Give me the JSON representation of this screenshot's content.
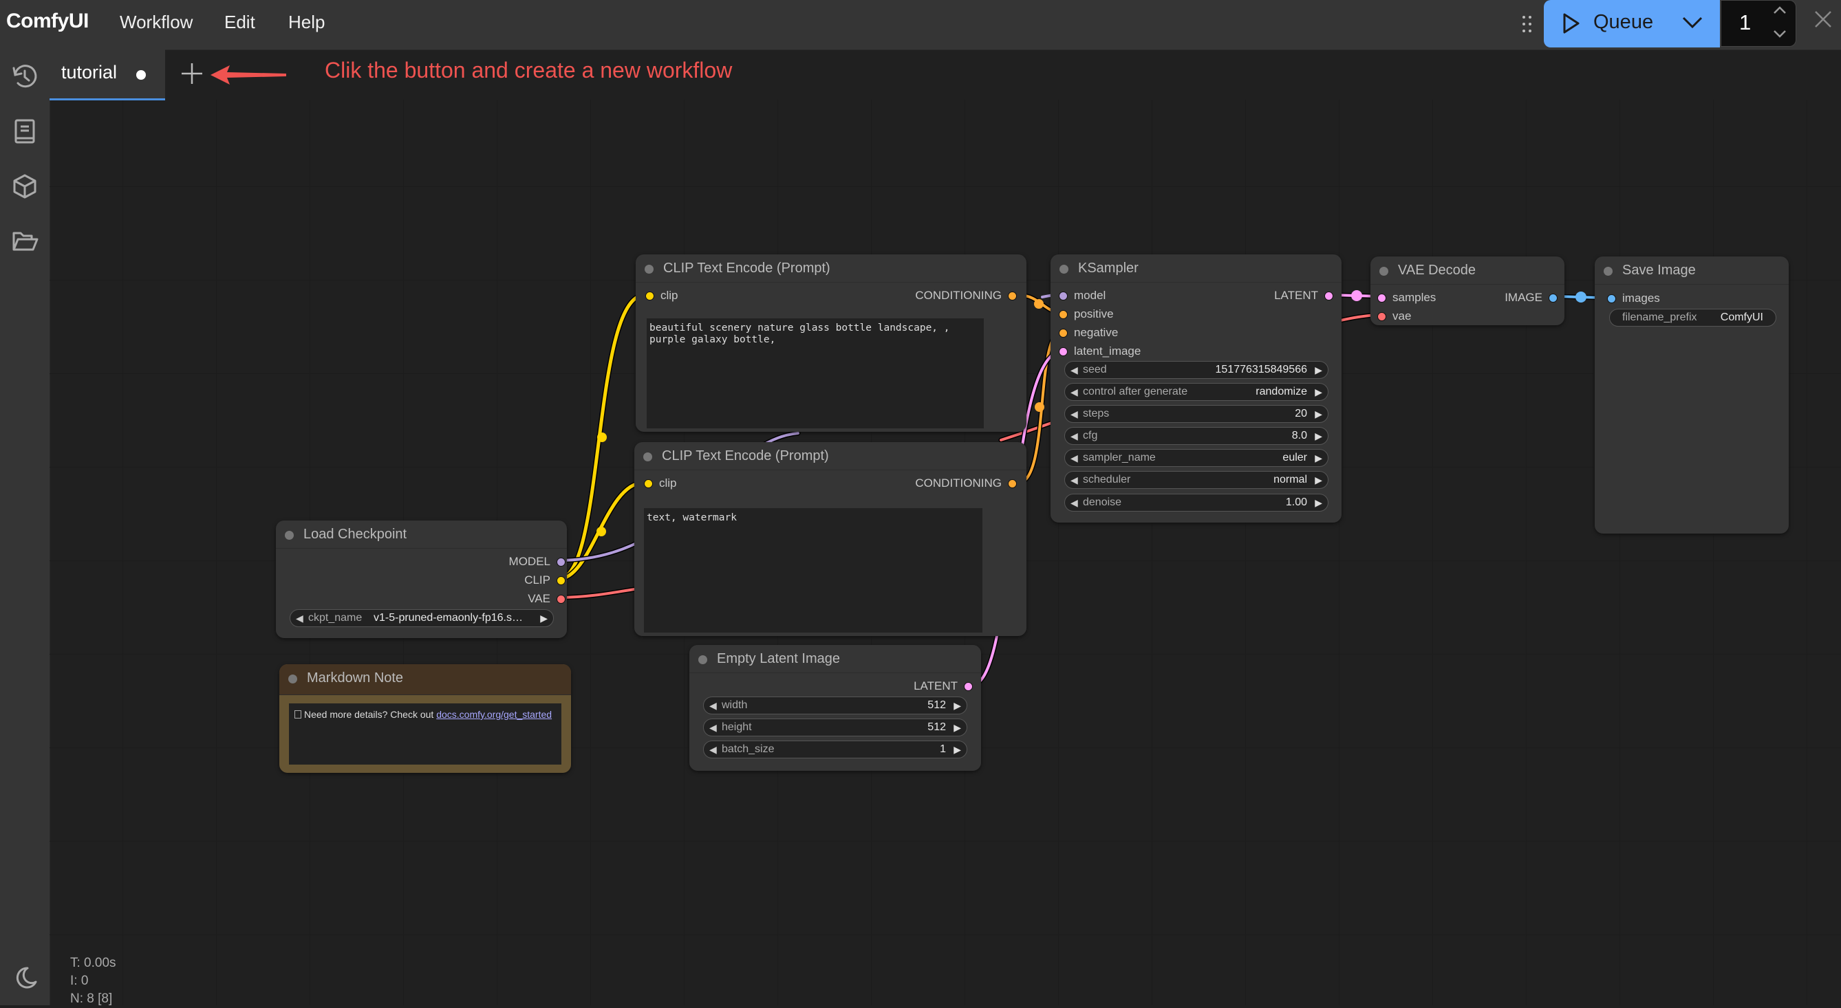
{
  "app": {
    "logo": "ComfyUI"
  },
  "menu": {
    "items": [
      "Workflow",
      "Edit",
      "Help"
    ]
  },
  "queue": {
    "label": "Queue",
    "count": "1"
  },
  "sidebar": {
    "icons": [
      "history-icon",
      "book-icon",
      "cube-icon",
      "folder-open-icon"
    ],
    "bottom_icon": "moon-icon"
  },
  "tabs": [
    {
      "label": "tutorial",
      "unsaved": true
    }
  ],
  "annotation": {
    "text": "Clik the button and create a new workflow",
    "color": "#ef5350"
  },
  "colors": {
    "accent": "#60a5fa",
    "clip": "#ffd500",
    "model": "#b39ddb",
    "vae": "#ff6e6e",
    "conditioning": "#ffa931",
    "latent": "#ff9cf9",
    "image": "#64b5f6"
  },
  "nodes": {
    "clip_pos": {
      "title": "CLIP Text Encode (Prompt)",
      "input": "clip",
      "output": "CONDITIONING",
      "text": "beautiful scenery nature glass bottle landscape, , purple galaxy bottle,"
    },
    "clip_neg": {
      "title": "CLIP Text Encode (Prompt)",
      "input": "clip",
      "output": "CONDITIONING",
      "text": "text, watermark"
    },
    "ksampler": {
      "title": "KSampler",
      "inputs": [
        "model",
        "positive",
        "negative",
        "latent_image"
      ],
      "output": "LATENT",
      "widgets": [
        {
          "name": "seed",
          "value": "151776315849566"
        },
        {
          "name": "control after generate",
          "value": "randomize"
        },
        {
          "name": "steps",
          "value": "20"
        },
        {
          "name": "cfg",
          "value": "8.0"
        },
        {
          "name": "sampler_name",
          "value": "euler"
        },
        {
          "name": "scheduler",
          "value": "normal"
        },
        {
          "name": "denoise",
          "value": "1.00"
        }
      ]
    },
    "vae_decode": {
      "title": "VAE Decode",
      "inputs": [
        "samples",
        "vae"
      ],
      "output": "IMAGE"
    },
    "save_image": {
      "title": "Save Image",
      "input": "images",
      "widget": {
        "name": "filename_prefix",
        "value": "ComfyUI"
      }
    },
    "load_checkpoint": {
      "title": "Load Checkpoint",
      "outputs": [
        "MODEL",
        "CLIP",
        "VAE"
      ],
      "widget": {
        "name": "ckpt_name",
        "value": "v1-5-pruned-emaonly-fp16.s…"
      }
    },
    "markdown_note": {
      "title": "Markdown Note",
      "text": "Need more details? Check out ",
      "link": "docs.comfy.org/get_started"
    },
    "empty_latent": {
      "title": "Empty Latent Image",
      "output": "LATENT",
      "widgets": [
        {
          "name": "width",
          "value": "512"
        },
        {
          "name": "height",
          "value": "512"
        },
        {
          "name": "batch_size",
          "value": "1"
        }
      ]
    }
  },
  "stats": {
    "time": "T: 0.00s",
    "i": "I: 0",
    "n": "N: 8 [8]"
  }
}
